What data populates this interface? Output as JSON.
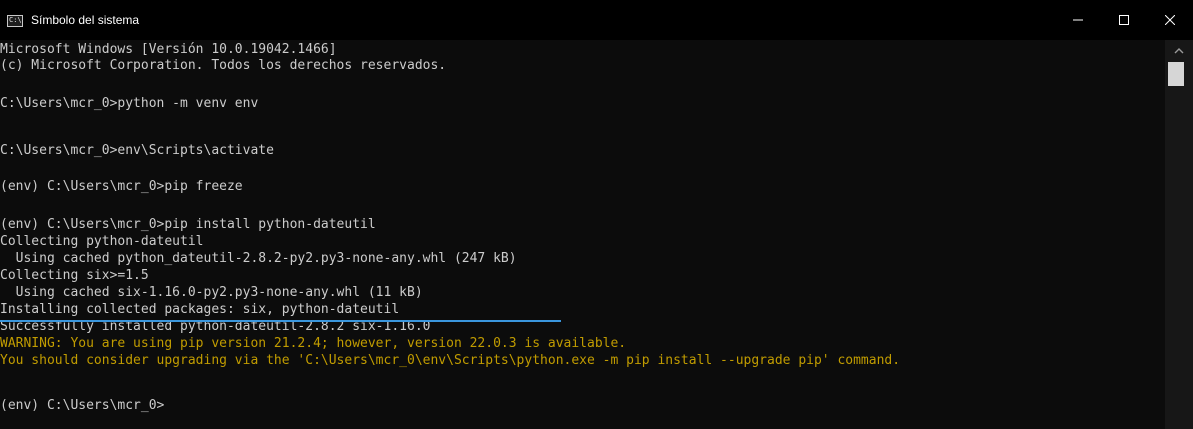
{
  "window": {
    "title": "Símbolo del sistema",
    "icon_label": "C:\\"
  },
  "controls": {
    "minimize": "minimize-icon",
    "maximize": "maximize-icon",
    "close": "close-icon"
  },
  "terminal": {
    "lines": [
      "Microsoft Windows [Versión 10.0.19042.1466]",
      "(c) Microsoft Corporation. Todos los derechos reservados.",
      "",
      "C:\\Users\\mcr_0>python -m venv env",
      "",
      "C:\\Users\\mcr_0>env\\Scripts\\activate",
      "",
      "(env) C:\\Users\\mcr_0>pip freeze",
      "",
      "(env) C:\\Users\\mcr_0>pip install python-dateutil",
      "Collecting python-dateutil",
      "  Using cached python_dateutil-2.8.2-py2.py3-none-any.whl (247 kB)",
      "Collecting six>=1.5",
      "  Using cached six-1.16.0-py2.py3-none-any.whl (11 kB)",
      "Installing collected packages: six, python-dateutil",
      "Successfully installed python-dateutil-2.8.2 six-1.16.0",
      "WARNING: You are using pip version 21.2.4; however, version 22.0.3 is available.",
      "You should consider upgrading via the 'C:\\Users\\mcr_0\\env\\Scripts\\python.exe -m pip install --upgrade pip' command.",
      "",
      "(env) C:\\Users\\mcr_0>"
    ]
  },
  "colors": {
    "background": "#0c0c0c",
    "text": "#cccccc",
    "warning": "#c19c00",
    "highlight": "#3a96dd"
  }
}
